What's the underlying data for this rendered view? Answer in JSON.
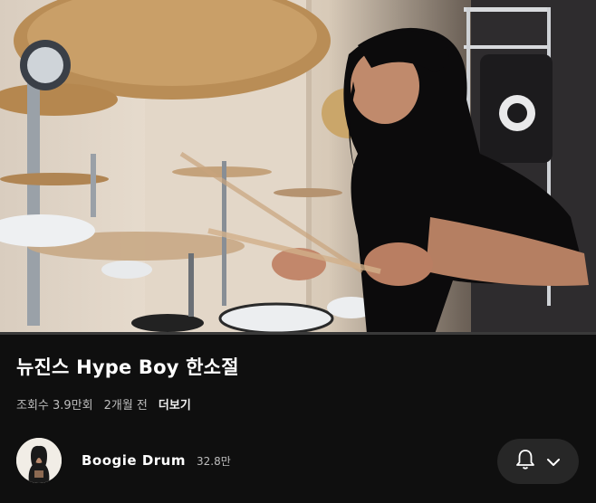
{
  "video": {
    "description_icon": "drummer-video-frame",
    "progress_fraction": 0.0
  },
  "title": "뉴진스 Hype Boy 한소절",
  "meta": {
    "views": "조회수 3.9만회",
    "age": "2개월 전",
    "more": "더보기"
  },
  "channel": {
    "name": "Boogie Drum",
    "subscribers": "32.8만"
  },
  "subscribe_menu": {
    "bell_icon": "bell-icon",
    "chevron_icon": "chevron-down-icon"
  },
  "colors": {
    "background": "#0f0f0f",
    "button_bg": "#272727",
    "secondary_text": "#bdbdbd"
  }
}
